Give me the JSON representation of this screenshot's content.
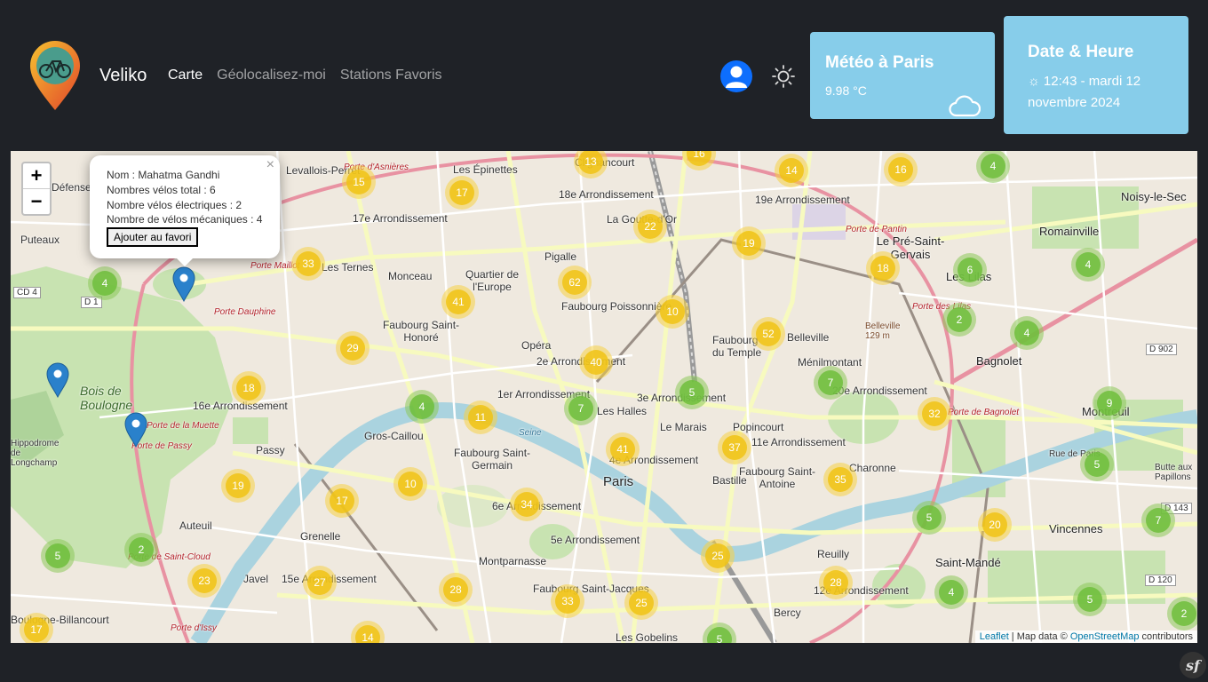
{
  "navbar": {
    "brand": "Veliko",
    "links": [
      {
        "label": "Carte",
        "active": true
      },
      {
        "label": "Géolocalisez-moi",
        "active": false
      },
      {
        "label": "Stations Favoris",
        "active": false
      }
    ]
  },
  "weather": {
    "title": "Météo à Paris",
    "temperature": "9.98 °C",
    "icon": "cloud-icon"
  },
  "datetime": {
    "title": "Date & Heure",
    "value": "☼ 12:43 - mardi 12 novembre 2024"
  },
  "map": {
    "zoom_in": "+",
    "zoom_out": "−",
    "popup": {
      "name": "Nom : Mahatma Gandhi",
      "total": "Nombres vélos total : 6",
      "electric": "Nombre vélos électriques : 2",
      "mechanical": "Nombre de vélos mécaniques : 4",
      "button": "Ajouter au favori",
      "close": "×"
    },
    "attribution": {
      "leaflet": "Leaflet",
      "sep": " | Map data © ",
      "osm": "OpenStreetMap",
      "tail": " contributors"
    },
    "labels": {
      "levallois": "Levallois-Perret",
      "epinettes": "Les Épinettes",
      "clignancourt": "Clignancourt",
      "arr18": "18e Arrondissement",
      "arr19": "19e Arrondissement",
      "arr17": "17e Arrondissement",
      "goutte": "La Goutte-d'Or",
      "puteaux": "Puteaux",
      "defense": "Défense",
      "ternes": "Les Ternes",
      "monceau": "Monceau",
      "quartier_europe": "Quartier de l'Europe",
      "pigalle": "Pigalle",
      "faubourg_poissonniere": "Faubourg Poissonnière",
      "faubourg_st_honore": "Faubourg Saint-Honoré",
      "opera": "Opéra",
      "arr2": "2e Arrondissement",
      "faubourg_temple": "Faubourg du Temple",
      "belleville": "Belleville",
      "menilmontant": "Ménilmontant",
      "arr20": "20e Arrondissement",
      "bagnolet": "Bagnolet",
      "montreuil": "Montreuil",
      "romainville": "Romainville",
      "noisy": "Noisy-le-Sec",
      "pre_st_gervais": "Le Pré-Saint-Gervais",
      "lilas": "Les Lilas",
      "bois_boulogne": "Bois de Boulogne",
      "arr16": "16e Arrondissement",
      "arr1": "1er Arrondissement",
      "arr3": "3e Arrondissement",
      "halles": "Les Halles",
      "gros_caillou": "Gros-Caillou",
      "passy": "Passy",
      "marais": "Le Marais",
      "popincourt": "Popincourt",
      "arr11": "11e Arrondissement",
      "faubourg_st_germain": "Faubourg Saint-Germain",
      "arr4": "4e Arrondissement",
      "paris": "Paris",
      "bastille": "Bastille",
      "charonne": "Charonne",
      "faubourg_st_antoine": "Faubourg Saint-Antoine",
      "auteuil": "Auteuil",
      "grenelle": "Grenelle",
      "arr6": "6e Arrondissement",
      "arr5": "5e Arrondissement",
      "montparnasse": "Montparnasse",
      "javel": "Javel",
      "arr15": "15e Arrondissement",
      "faubourg_st_jacques": "Faubourg Saint-Jacques",
      "reuilly": "Reuilly",
      "arr12": "12e Arrondissement",
      "bercy": "Bercy",
      "st_mande": "Saint-Mandé",
      "vincennes": "Vincennes",
      "gobelins": "Les Gobelins",
      "boulogne": "Boulogne-Billancourt",
      "hippodrome": "Hippodrome de Longchamp",
      "butte": "Butte aux Papillons",
      "belleville_alt": "Belleville 129 m",
      "porte_asnieres": "Porte d'Asnières",
      "porte_maillot": "Porte Maillot",
      "porte_dauphine": "Porte Dauphine",
      "porte_muette": "Porte de la Muette",
      "porte_passy": "Porte de Passy",
      "porte_st_cloud": "Porte de Saint-Cloud",
      "porte_lilas": "Porte des Lilas",
      "porte_bagnolet": "Porte de Bagnolet",
      "porte_pantin": "Porte de Pantin",
      "porte_issy": "Porte d'Issy",
      "d1": "D 1",
      "cd4": "CD 4",
      "d902": "D 902",
      "d143": "D 143",
      "d120": "D 120",
      "rue_paris": "Rue de Paris",
      "seine": "Seine"
    },
    "clusters": [
      {
        "count": "15",
        "color": "yellow"
      },
      {
        "count": "17",
        "color": "yellow"
      },
      {
        "count": "13",
        "color": "yellow"
      },
      {
        "count": "16",
        "color": "yellow"
      },
      {
        "count": "14",
        "color": "yellow"
      },
      {
        "count": "16",
        "color": "yellow"
      },
      {
        "count": "4",
        "color": "green"
      },
      {
        "count": "22",
        "color": "yellow"
      },
      {
        "count": "19",
        "color": "yellow"
      },
      {
        "count": "33",
        "color": "yellow"
      },
      {
        "count": "4",
        "color": "green"
      },
      {
        "count": "62",
        "color": "yellow"
      },
      {
        "count": "41",
        "color": "yellow"
      },
      {
        "count": "10",
        "color": "yellow"
      },
      {
        "count": "18",
        "color": "yellow"
      },
      {
        "count": "6",
        "color": "green"
      },
      {
        "count": "4",
        "color": "green"
      },
      {
        "count": "2",
        "color": "green"
      },
      {
        "count": "52",
        "color": "yellow"
      },
      {
        "count": "4",
        "color": "green"
      },
      {
        "count": "29",
        "color": "yellow"
      },
      {
        "count": "40",
        "color": "yellow"
      },
      {
        "count": "18",
        "color": "yellow"
      },
      {
        "count": "5",
        "color": "green"
      },
      {
        "count": "7",
        "color": "green"
      },
      {
        "count": "4",
        "color": "green"
      },
      {
        "count": "11",
        "color": "yellow"
      },
      {
        "count": "7",
        "color": "green"
      },
      {
        "count": "32",
        "color": "yellow"
      },
      {
        "count": "9",
        "color": "green"
      },
      {
        "count": "41",
        "color": "yellow"
      },
      {
        "count": "37",
        "color": "yellow"
      },
      {
        "count": "5",
        "color": "green"
      },
      {
        "count": "19",
        "color": "yellow"
      },
      {
        "count": "10",
        "color": "yellow"
      },
      {
        "count": "17",
        "color": "yellow"
      },
      {
        "count": "34",
        "color": "yellow"
      },
      {
        "count": "35",
        "color": "yellow"
      },
      {
        "count": "5",
        "color": "green"
      },
      {
        "count": "20",
        "color": "yellow"
      },
      {
        "count": "7",
        "color": "green"
      },
      {
        "count": "5",
        "color": "green"
      },
      {
        "count": "2",
        "color": "green"
      },
      {
        "count": "25",
        "color": "yellow"
      },
      {
        "count": "23",
        "color": "yellow"
      },
      {
        "count": "27",
        "color": "yellow"
      },
      {
        "count": "28",
        "color": "yellow"
      },
      {
        "count": "28",
        "color": "yellow"
      },
      {
        "count": "4",
        "color": "green"
      },
      {
        "count": "33",
        "color": "yellow"
      },
      {
        "count": "25",
        "color": "yellow"
      },
      {
        "count": "5",
        "color": "green"
      },
      {
        "count": "2",
        "color": "green"
      },
      {
        "count": "17",
        "color": "yellow"
      },
      {
        "count": "14",
        "color": "yellow"
      },
      {
        "count": "5",
        "color": "green"
      }
    ]
  },
  "colors": {
    "navbar_bg": "#1f2227",
    "card_bg": "#87cdea",
    "cluster_yellow": "#f0c314",
    "cluster_green": "#6ebe3c",
    "marker_blue": "#2a81cb"
  }
}
